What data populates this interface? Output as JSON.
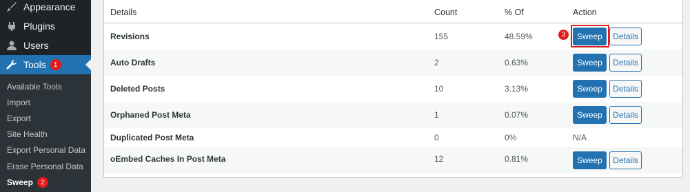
{
  "sidebar": {
    "menu": [
      {
        "label": "Appearance",
        "icon": "paintbrush-icon"
      },
      {
        "label": "Plugins",
        "icon": "plug-icon"
      },
      {
        "label": "Users",
        "icon": "user-icon"
      },
      {
        "label": "Tools",
        "icon": "wrench-icon",
        "badge": "1"
      }
    ],
    "submenu": [
      {
        "label": "Available Tools"
      },
      {
        "label": "Import"
      },
      {
        "label": "Export"
      },
      {
        "label": "Site Health"
      },
      {
        "label": "Export Personal Data"
      },
      {
        "label": "Erase Personal Data"
      },
      {
        "label": "Sweep",
        "badge": "2"
      }
    ]
  },
  "table": {
    "headers": {
      "details": "Details",
      "count": "Count",
      "percent": "% Of",
      "action": "Action"
    },
    "rows": [
      {
        "details": "Revisions",
        "count": "155",
        "percent": "48.59%",
        "sweep": "Sweep",
        "more": "Details"
      },
      {
        "details": "Auto Drafts",
        "count": "2",
        "percent": "0.63%",
        "sweep": "Sweep",
        "more": "Details"
      },
      {
        "details": "Deleted Posts",
        "count": "10",
        "percent": "3.13%",
        "sweep": "Sweep",
        "more": "Details"
      },
      {
        "details": "Orphaned Post Meta",
        "count": "1",
        "percent": "0.07%",
        "sweep": "Sweep",
        "more": "Details"
      },
      {
        "details": "Duplicated Post Meta",
        "count": "0",
        "percent": "0%",
        "na": "N/A"
      },
      {
        "details": "oEmbed Caches In Post Meta",
        "count": "12",
        "percent": "0.81%",
        "sweep": "Sweep",
        "more": "Details"
      }
    ]
  },
  "annotation": {
    "step": "3"
  },
  "colors": {
    "accent": "#2271b1",
    "sidebar": "#1d2327",
    "marker": "#e21b1b"
  }
}
